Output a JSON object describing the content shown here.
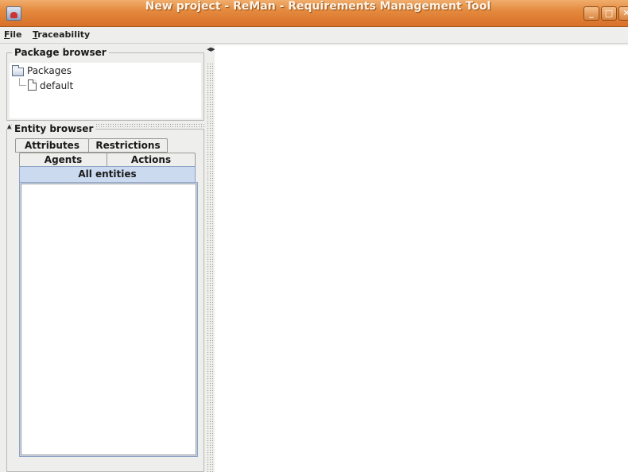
{
  "window": {
    "title": "New project - ReMan - Requirements Management Tool",
    "app_icon": "java-app-icon",
    "controls": {
      "minimize": "_",
      "maximize": "□",
      "close": "✕"
    }
  },
  "menubar": {
    "items": [
      {
        "mnemonic": "F",
        "rest": "ile"
      },
      {
        "mnemonic": "T",
        "rest": "raceability"
      }
    ]
  },
  "package_browser": {
    "title": "Package browser",
    "tree": {
      "root": {
        "label": "Packages",
        "icon": "folder-icon"
      },
      "children": [
        {
          "label": "default",
          "icon": "file-icon"
        }
      ]
    }
  },
  "splitter": {
    "arrows_vertical": "▲▼",
    "arrows_horizontal": "◀▶"
  },
  "entity_browser": {
    "title": "Entity browser",
    "tabs_row1": [
      "Attributes",
      "Restrictions"
    ],
    "tabs_row2": [
      "Agents",
      "Actions"
    ],
    "selected_tab": "All entities"
  },
  "colors": {
    "titlebar": "#e48a3e",
    "selected_tab": "#ccdaf0",
    "background": "#eeeeec"
  }
}
